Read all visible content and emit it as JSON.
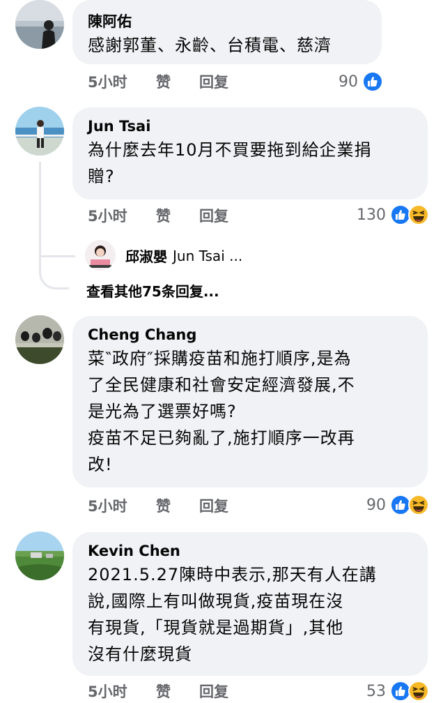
{
  "comments": [
    {
      "author": "陳阿佑",
      "lines": [
        "感謝郭董、永齡、台積電、慈濟"
      ],
      "time": "5小时",
      "like": "赞",
      "reply": "回复",
      "reactions": "90",
      "reaction_icons": [
        "like-icon"
      ]
    },
    {
      "author": "Jun Tsai",
      "lines": [
        "為什麼去年10月不買要拖到給企業捐",
        "贈?"
      ],
      "time": "5小时",
      "like": "赞",
      "reply": "回复",
      "reactions": "130",
      "reaction_icons": [
        "like-icon",
        "haha-icon"
      ],
      "reply_preview": {
        "author": "邱淑嬰",
        "text": "Jun Tsai ..."
      },
      "view_more": "查看其他75条回复..."
    },
    {
      "author": "Cheng Chang",
      "lines": [
        "菜‶政府″採購疫苗和施打順序,是為",
        "了全民健康和社會安定經濟發展,不",
        "是光為了選票好嗎?",
        "疫苗不足已夠亂了,施打順序一改再",
        "改!"
      ],
      "time": "5小时",
      "like": "赞",
      "reply": "回复",
      "reactions": "90",
      "reaction_icons": [
        "like-icon",
        "haha-icon"
      ]
    },
    {
      "author": "Kevin Chen",
      "lines": [
        "2021.5.27陳時中表示,那天有人在講",
        "說,國際上有叫做現貨,疫苗現在沒",
        "有現貨,「現貨就是過期貨」,其他",
        "沒有什麼現貨"
      ],
      "time": "5小时",
      "like": "赞",
      "reply": "回复",
      "reactions": "53",
      "reaction_icons": [
        "like-icon",
        "haha-icon"
      ]
    }
  ],
  "colors": {
    "bubble": "#f0f2f5",
    "meta_text": "#65676b",
    "like_blue": "#1877f2",
    "haha_yellow": "#f7b928"
  }
}
